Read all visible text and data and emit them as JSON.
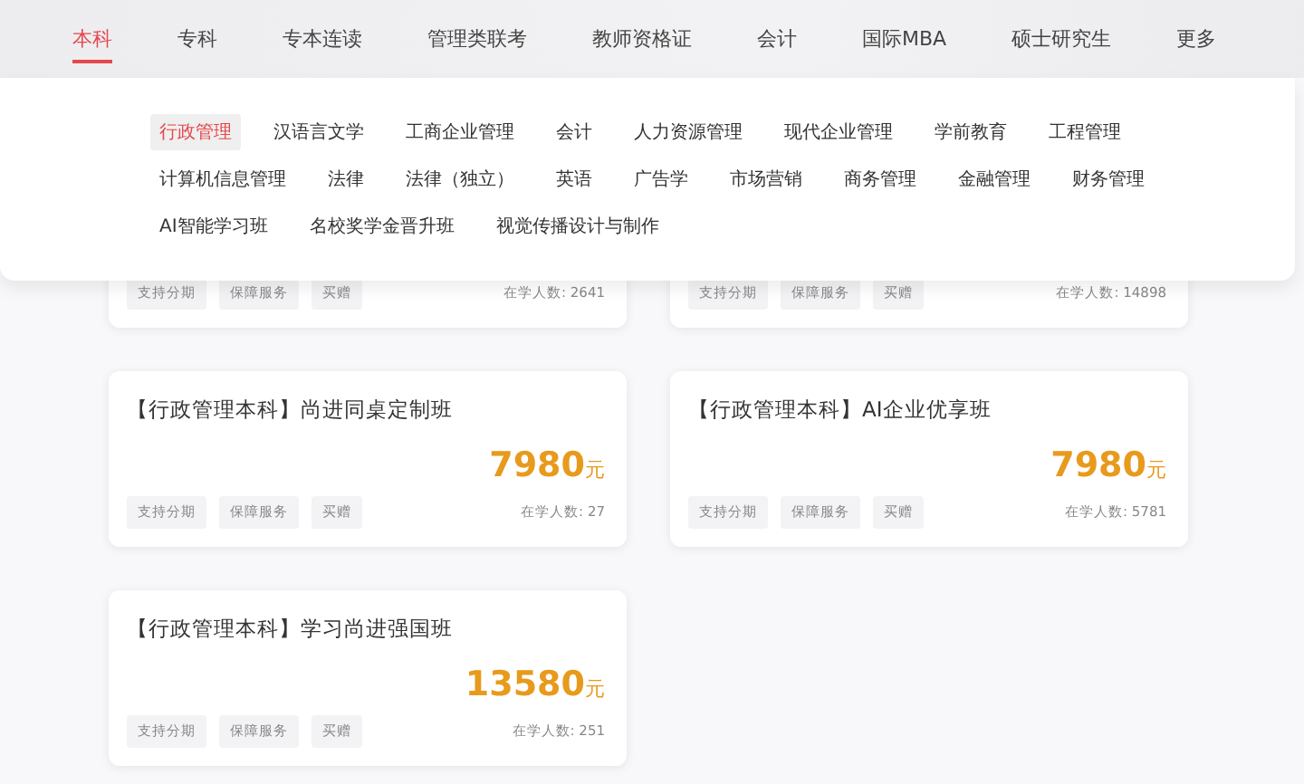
{
  "nav": [
    {
      "label": "本科",
      "selected": true
    },
    {
      "label": "专科",
      "selected": false
    },
    {
      "label": "专本连读",
      "selected": false
    },
    {
      "label": "管理类联考",
      "selected": false
    },
    {
      "label": "教师资格证",
      "selected": false
    },
    {
      "label": "会计",
      "selected": false
    },
    {
      "label": "国际MBA",
      "selected": false
    },
    {
      "label": "硕士研究生",
      "selected": false
    },
    {
      "label": "更多",
      "selected": false
    }
  ],
  "majors": [
    {
      "label": "行政管理",
      "selected": true
    },
    {
      "label": "汉语言文学",
      "selected": false
    },
    {
      "label": "工商企业管理",
      "selected": false
    },
    {
      "label": "会计",
      "selected": false
    },
    {
      "label": "人力资源管理",
      "selected": false
    },
    {
      "label": "现代企业管理",
      "selected": false
    },
    {
      "label": "学前教育",
      "selected": false
    },
    {
      "label": "工程管理",
      "selected": false
    },
    {
      "label": "计算机信息管理",
      "selected": false
    },
    {
      "label": "法律",
      "selected": false
    },
    {
      "label": "法律（独立）",
      "selected": false
    },
    {
      "label": "英语",
      "selected": false
    },
    {
      "label": "广告学",
      "selected": false
    },
    {
      "label": "市场营销",
      "selected": false
    },
    {
      "label": "商务管理",
      "selected": false
    },
    {
      "label": "金融管理",
      "selected": false
    },
    {
      "label": "财务管理",
      "selected": false
    },
    {
      "label": "AI智能学习班",
      "selected": false
    },
    {
      "label": "名校奖学金晋升班",
      "selected": false
    },
    {
      "label": "视觉传播设计与制作",
      "selected": false
    }
  ],
  "courses": [
    {
      "tags": [
        "支持分期",
        "保障服务",
        "买赠"
      ],
      "enrolled": "在学人数: 2641"
    },
    {
      "tags": [
        "支持分期",
        "保障服务",
        "买赠"
      ],
      "enrolled": "在学人数: 14898"
    },
    {
      "title": "【行政管理本科】尚进同桌定制班",
      "price": "7980",
      "unit": "元",
      "tags": [
        "支持分期",
        "保障服务",
        "买赠"
      ],
      "enrolled": "在学人数: 27"
    },
    {
      "title": "【行政管理本科】AI企业优享班",
      "price": "7980",
      "unit": "元",
      "tags": [
        "支持分期",
        "保障服务",
        "买赠"
      ],
      "enrolled": "在学人数: 5781"
    },
    {
      "title": "【行政管理本科】学习尚进强国班",
      "price": "13580",
      "unit": "元",
      "tags": [
        "支持分期",
        "保障服务",
        "买赠"
      ],
      "enrolled": "在学人数: 251"
    }
  ]
}
